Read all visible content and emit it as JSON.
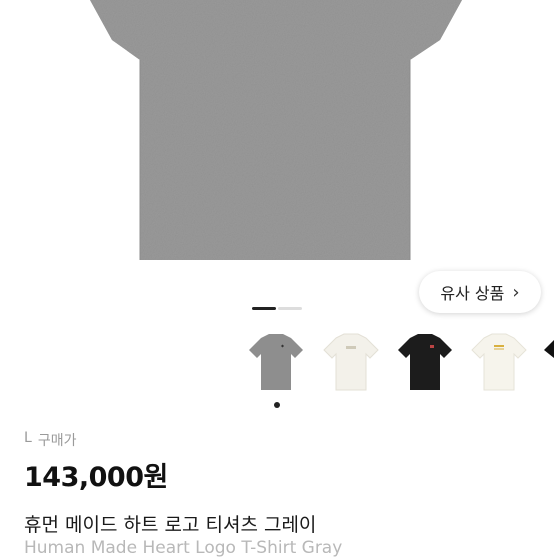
{
  "similar_button": {
    "label": "유사 상품",
    "chevron": "chevron-right-icon"
  },
  "thumbnails": [
    {
      "name": "thumb-gray",
      "color": "#8e8e8e"
    },
    {
      "name": "thumb-white",
      "color": "#f3f1ea"
    },
    {
      "name": "thumb-black",
      "color": "#1c1c1c"
    },
    {
      "name": "thumb-cream",
      "color": "#f6f4ec"
    }
  ],
  "product": {
    "size": "L",
    "price_type": "구매가",
    "price": "143,000원",
    "title_ko": "휴먼 메이드 하트 로고 티셔츠 그레이",
    "title_en": "Human Made Heart Logo T-Shirt Gray"
  },
  "colors": {
    "shirt_gray": "#9a9a9a",
    "accent": "#111111"
  }
}
